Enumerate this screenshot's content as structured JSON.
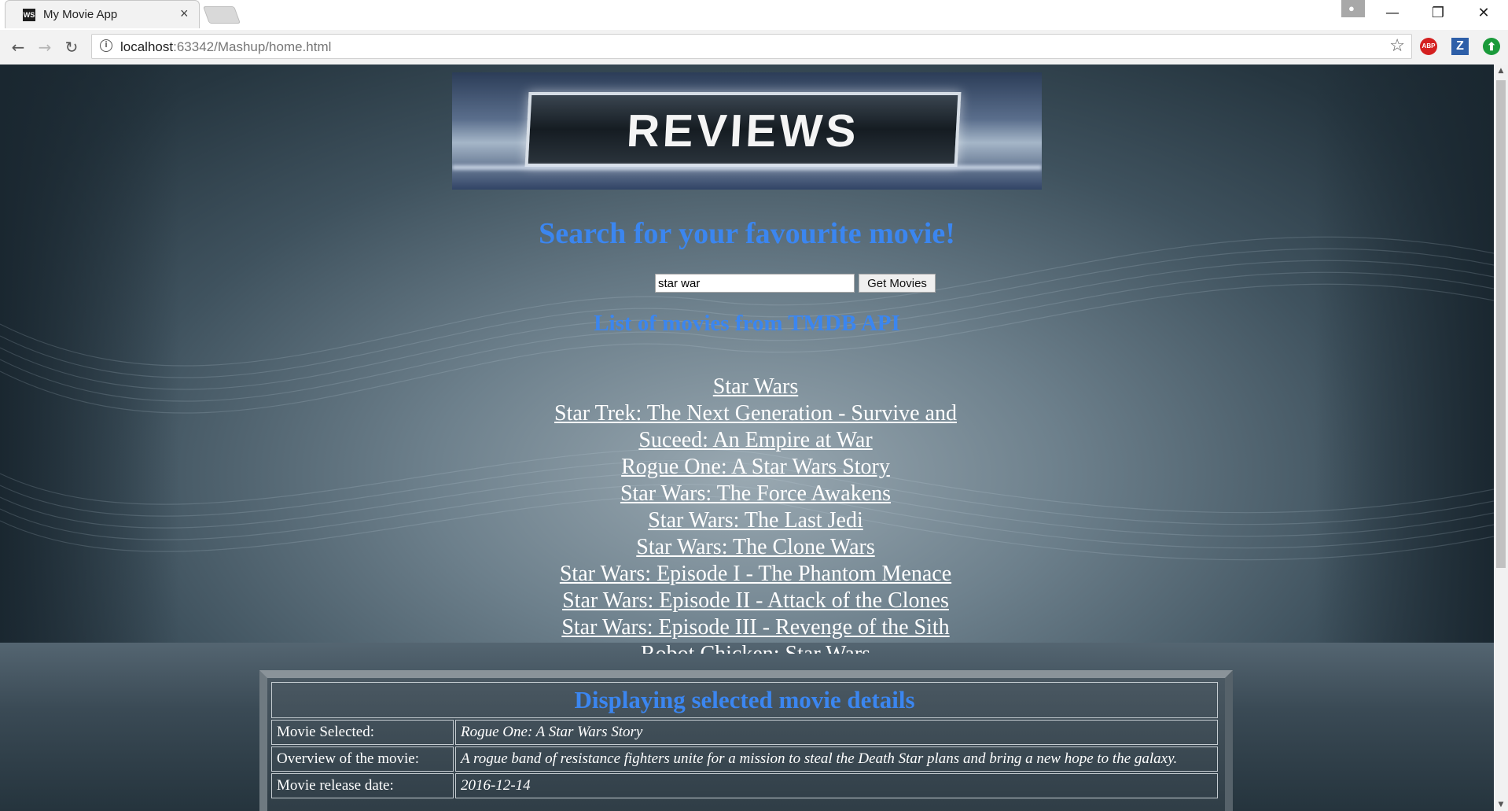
{
  "browser": {
    "tab_title": "My Movie App",
    "tab_favicon": "WS",
    "tab_close": "×",
    "url_host": "localhost",
    "url_path": ":63342/Mashup/home.html",
    "window_controls": {
      "minimize": "—",
      "restore": "❐",
      "close": "✕"
    },
    "nav": {
      "back": "←",
      "forward": "→",
      "reload": "↻"
    },
    "bookmark_star": "☆",
    "extensions": {
      "abp": "ABP",
      "z": "Z",
      "green": "⬆"
    }
  },
  "banner": {
    "text": "REVIEWS"
  },
  "search": {
    "heading": "Search for your favourite movie!",
    "input_value": "star war",
    "button_label": "Get Movies"
  },
  "list": {
    "heading": "List of movies from TMDB API",
    "movies": [
      "Star Wars",
      "Star Trek: The Next Generation - Survive and Suceed: An Empire at War",
      "Rogue One: A Star Wars Story",
      "Star Wars: The Force Awakens",
      "Star Wars: The Last Jedi",
      "Star Wars: The Clone Wars",
      "Star Wars: Episode I - The Phantom Menace",
      "Star Wars: Episode II - Attack of the Clones",
      "Star Wars: Episode III - Revenge of the Sith",
      "Robot Chicken: Star Wars"
    ]
  },
  "details": {
    "heading": "Displaying selected movie details",
    "rows": [
      {
        "label": "Movie Selected:",
        "value": "Rogue One: A Star Wars Story"
      },
      {
        "label": "Overview of the movie:",
        "value": "A rogue band of resistance fighters unite for a mission to steal the Death Star plans and bring a new hope to the galaxy."
      },
      {
        "label": "Movie release date:",
        "value": "2016-12-14"
      }
    ]
  },
  "scroll_arrows": {
    "up": "▲",
    "down": "▼"
  }
}
